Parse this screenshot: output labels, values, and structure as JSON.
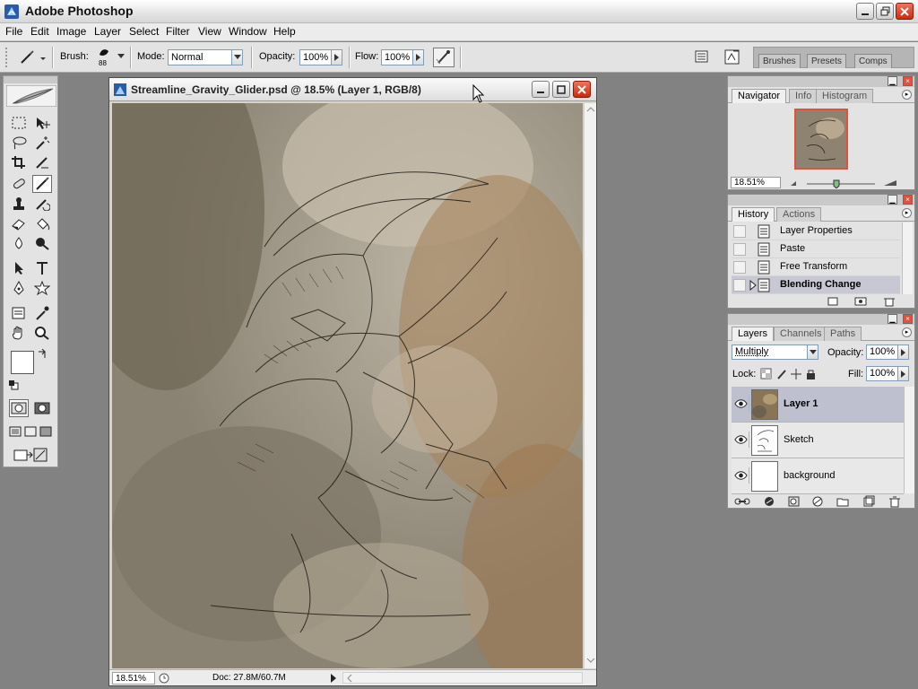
{
  "app": {
    "title": "Adobe Photoshop"
  },
  "menu": [
    "File",
    "Edit",
    "Image",
    "Layer",
    "Select",
    "Filter",
    "View",
    "Window",
    "Help"
  ],
  "options": {
    "brush_label": "Brush:",
    "brush_size": "88",
    "mode_label": "Mode:",
    "mode_value": "Normal",
    "opacity_label": "Opacity:",
    "opacity_value": "100%",
    "flow_label": "Flow:",
    "flow_value": "100%"
  },
  "palette_well": {
    "tabs": [
      "Brushes",
      "Presets",
      "Comps"
    ]
  },
  "document": {
    "title": "Streamline_Gravity_Glider.psd @ 18.5% (Layer 1, RGB/8)",
    "zoom": "18.51%",
    "doc_size": "Doc: 27.8M/60.7M"
  },
  "navigator": {
    "tabs": [
      "Navigator",
      "Info",
      "Histogram"
    ],
    "zoom": "18.51%"
  },
  "history": {
    "tabs": [
      "History",
      "Actions"
    ],
    "items": [
      {
        "label": "Layer Properties"
      },
      {
        "label": "Paste"
      },
      {
        "label": "Free Transform"
      },
      {
        "label": "Blending Change"
      }
    ]
  },
  "layers": {
    "tabs": [
      "Layers",
      "Channels",
      "Paths"
    ],
    "blend_mode": "Multiply",
    "opacity_label": "Opacity:",
    "opacity_value": "100%",
    "lock_label": "Lock:",
    "fill_label": "Fill:",
    "fill_value": "100%",
    "items": [
      {
        "name": "Layer 1"
      },
      {
        "name": "Sketch"
      },
      {
        "name": "background"
      }
    ]
  },
  "colors": {
    "accent": "#e0523d",
    "selection": "#bfc0cf",
    "workspace": "#828282"
  },
  "icons": [
    "photoshop-app-icon",
    "feather-logo-icon",
    "brush-tool-icon",
    "airbrush-icon",
    "eye-icon",
    "pointer-cursor-icon"
  ]
}
